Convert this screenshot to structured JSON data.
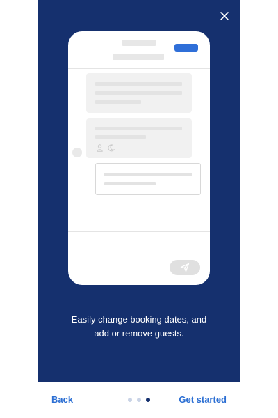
{
  "onboarding": {
    "caption": "Easily change booking dates, and add or remove guests.",
    "step_index": 3,
    "step_total": 3,
    "icons": {
      "close": "close-icon",
      "person": "person-icon",
      "moon": "moon-icon",
      "send": "paper-plane-icon"
    }
  },
  "footer": {
    "back_label": "Back",
    "next_label": "Get started"
  },
  "colors": {
    "modal_bg": "#15306e",
    "accent": "#2c6fd3",
    "dot_active": "#15306e",
    "dot_inactive": "#c9d3e6"
  }
}
